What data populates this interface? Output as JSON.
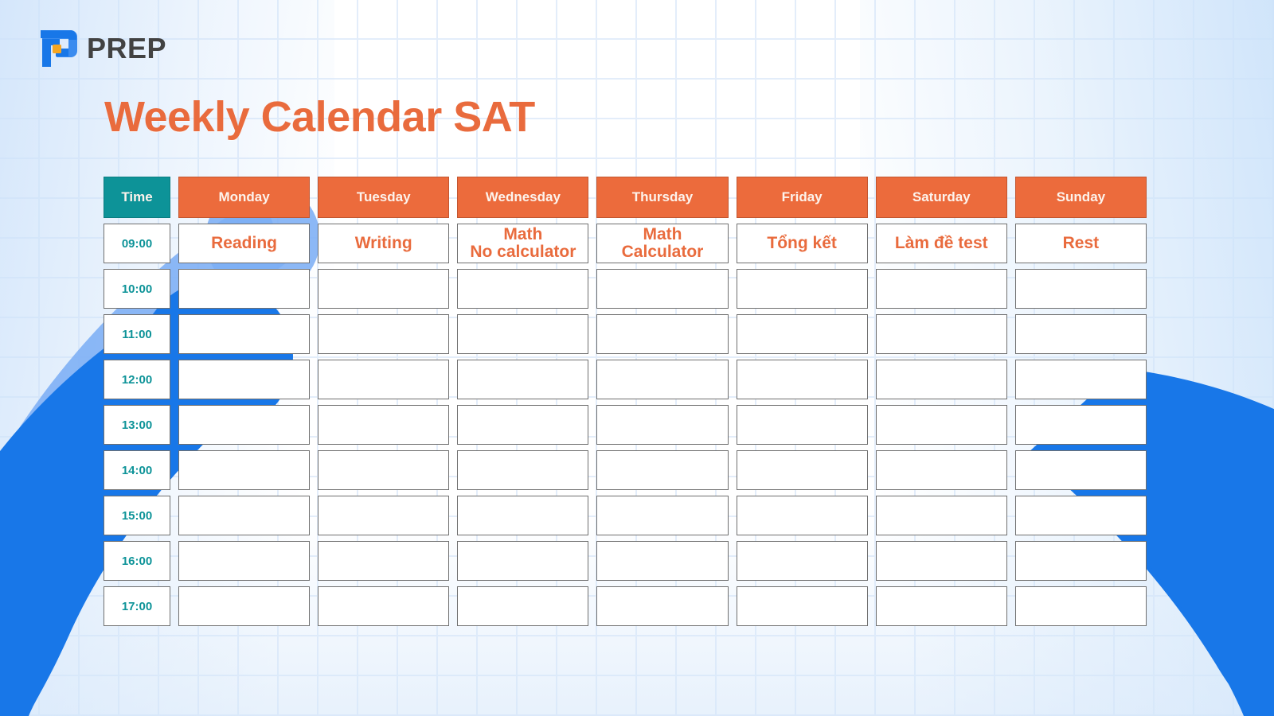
{
  "brand": {
    "logo_icon": "prep-logo-icon",
    "name": "PREP",
    "mark_colors": {
      "blue": "#1877e8",
      "light_blue": "#4a90e2",
      "dot": "#f5a623"
    }
  },
  "header": {
    "title": "Weekly Calendar SAT",
    "title_color": "#e96b3d"
  },
  "theme": {
    "orange": "#ec6b3c",
    "teal": "#0d9398",
    "blue": "#1877e8",
    "light_blue": "#7caef5",
    "grid_line": "#e3edfa",
    "cell_border": "#6f6f6f"
  },
  "calendar": {
    "columns": [
      {
        "key": "time",
        "label": "Time",
        "type": "time"
      },
      {
        "key": "mon",
        "label": "Monday",
        "type": "day"
      },
      {
        "key": "tue",
        "label": "Tuesday",
        "type": "day"
      },
      {
        "key": "wed",
        "label": "Wednesday",
        "type": "day"
      },
      {
        "key": "thu",
        "label": "Thursday",
        "type": "day"
      },
      {
        "key": "fri",
        "label": "Friday",
        "type": "day"
      },
      {
        "key": "sat",
        "label": "Saturday",
        "type": "day"
      },
      {
        "key": "sun",
        "label": "Sunday",
        "type": "day"
      }
    ],
    "rows": [
      {
        "time": "09:00",
        "cells": [
          "Reading",
          "Writing",
          "Math\nNo calculator",
          "Math\nCalculator",
          "Tổng kết",
          "Làm đề test",
          "Rest"
        ]
      },
      {
        "time": "10:00",
        "cells": [
          "",
          "",
          "",
          "",
          "",
          "",
          ""
        ]
      },
      {
        "time": "11:00",
        "cells": [
          "",
          "",
          "",
          "",
          "",
          "",
          ""
        ]
      },
      {
        "time": "12:00",
        "cells": [
          "",
          "",
          "",
          "",
          "",
          "",
          ""
        ]
      },
      {
        "time": "13:00",
        "cells": [
          "",
          "",
          "",
          "",
          "",
          "",
          ""
        ]
      },
      {
        "time": "14:00",
        "cells": [
          "",
          "",
          "",
          "",
          "",
          "",
          ""
        ]
      },
      {
        "time": "15:00",
        "cells": [
          "",
          "",
          "",
          "",
          "",
          "",
          ""
        ]
      },
      {
        "time": "16:00",
        "cells": [
          "",
          "",
          "",
          "",
          "",
          "",
          ""
        ]
      },
      {
        "time": "17:00",
        "cells": [
          "",
          "",
          "",
          "",
          "",
          "",
          ""
        ]
      }
    ]
  }
}
